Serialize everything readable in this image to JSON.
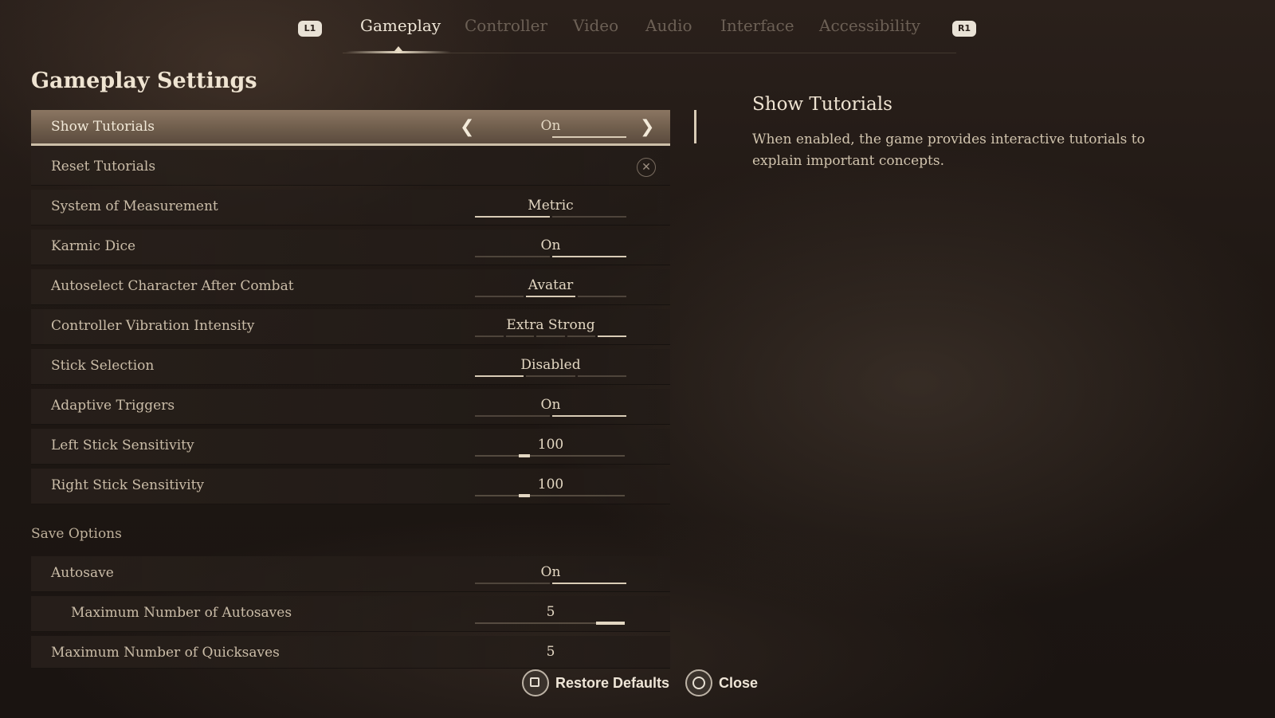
{
  "tabs": {
    "left_bumper": "L1",
    "right_bumper": "R1",
    "items": [
      {
        "label": "Gameplay",
        "active": true
      },
      {
        "label": "Controller",
        "active": false
      },
      {
        "label": "Video",
        "active": false
      },
      {
        "label": "Audio",
        "active": false
      },
      {
        "label": "Interface",
        "active": false
      },
      {
        "label": "Accessibility",
        "active": false
      }
    ]
  },
  "page_title": "Gameplay Settings",
  "settings": [
    {
      "label": "Show Tutorials",
      "value": "On",
      "selected": true
    },
    {
      "label": "Reset Tutorials",
      "icon": "close-icon"
    },
    {
      "label": "System of Measurement",
      "value": "Metric",
      "option_index": 0,
      "option_count": 2
    },
    {
      "label": "Karmic Dice",
      "value": "On",
      "option_index": 1,
      "option_count": 2
    },
    {
      "label": "Autoselect Character After Combat",
      "value": "Avatar",
      "option_index": 1,
      "option_count": 3
    },
    {
      "label": "Controller Vibration Intensity",
      "value": "Extra Strong",
      "option_index": 4,
      "option_count": 5
    },
    {
      "label": "Stick Selection",
      "value": "Disabled",
      "option_index": 0,
      "option_count": 3
    },
    {
      "label": "Adaptive Triggers",
      "value": "On",
      "option_index": 1,
      "option_count": 2
    },
    {
      "label": "Left Stick Sensitivity",
      "value": "100",
      "slider_fraction": 0.33
    },
    {
      "label": "Right Stick Sensitivity",
      "value": "100",
      "slider_fraction": 0.33
    }
  ],
  "save_options": {
    "header": "Save Options",
    "items": [
      {
        "label": "Autosave",
        "value": "On",
        "option_index": 1,
        "option_count": 2
      },
      {
        "label": "Maximum Number of Autosaves",
        "value": "5",
        "slider_fraction": 1.0,
        "indent": true
      },
      {
        "label": "Maximum Number of Quicksaves",
        "value": "5"
      }
    ]
  },
  "description": {
    "title": "Show Tutorials",
    "text": "When enabled, the game provides interactive tutorials to explain important concepts."
  },
  "footer": {
    "restore_label": "Restore Defaults",
    "restore_icon": "square-button-icon",
    "close_label": "Close",
    "close_icon": "circle-button-icon"
  }
}
